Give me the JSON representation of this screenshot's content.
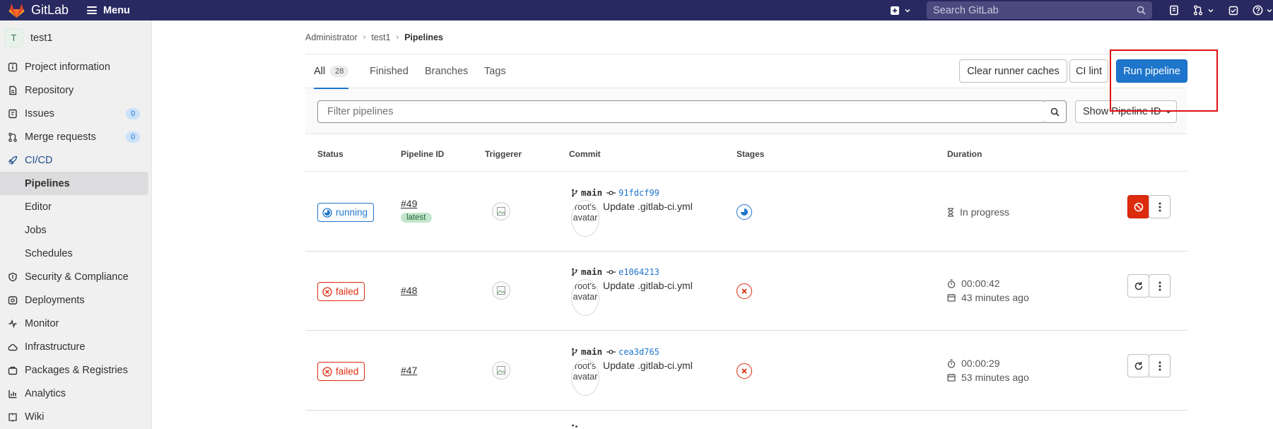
{
  "topbar": {
    "brand": "GitLab",
    "menu_label": "Menu",
    "search_placeholder": "Search GitLab"
  },
  "sidebar": {
    "project_initial": "T",
    "project_name": "test1",
    "items": [
      {
        "label": "Project information",
        "icon": "info-icon"
      },
      {
        "label": "Repository",
        "icon": "doc-icon"
      },
      {
        "label": "Issues",
        "icon": "issues-icon",
        "badge": "0"
      },
      {
        "label": "Merge requests",
        "icon": "merge-request-icon",
        "badge": "0"
      },
      {
        "label": "CI/CD",
        "icon": "rocket-icon"
      }
    ],
    "cicd_sub": [
      "Pipelines",
      "Editor",
      "Jobs",
      "Schedules"
    ],
    "more_items": [
      {
        "label": "Security & Compliance",
        "icon": "shield-icon"
      },
      {
        "label": "Deployments",
        "icon": "deployments-icon"
      },
      {
        "label": "Monitor",
        "icon": "monitor-icon"
      },
      {
        "label": "Infrastructure",
        "icon": "cloud-icon"
      },
      {
        "label": "Packages & Registries",
        "icon": "package-icon"
      },
      {
        "label": "Analytics",
        "icon": "chart-icon"
      },
      {
        "label": "Wiki",
        "icon": "book-icon"
      }
    ]
  },
  "breadcrumb": {
    "items": [
      "Administrator",
      "test1",
      "Pipelines"
    ]
  },
  "tabs": {
    "all": "All",
    "all_count": "28",
    "finished": "Finished",
    "branches": "Branches",
    "tags": "Tags"
  },
  "actions": {
    "clear_cache": "Clear runner caches",
    "ci_lint": "CI lint",
    "run_pipeline": "Run pipeline"
  },
  "filter": {
    "placeholder": "Filter pipelines",
    "show_id": "Show Pipeline ID"
  },
  "table": {
    "headers": [
      "Status",
      "Pipeline ID",
      "Triggerer",
      "Commit",
      "Stages",
      "Duration"
    ],
    "rows": [
      {
        "status": "running",
        "id": "#49",
        "badge": "latest",
        "branch": "main",
        "sha": "91fdcf99",
        "avatar_alt": "root's avatar",
        "message": "Update .gitlab-ci.yml",
        "duration": "In progress",
        "ago": ""
      },
      {
        "status": "failed",
        "id": "#48",
        "badge": "",
        "branch": "main",
        "sha": "e1064213",
        "avatar_alt": "root's avatar",
        "message": "Update .gitlab-ci.yml",
        "duration": "00:00:42",
        "ago": "43 minutes ago"
      },
      {
        "status": "failed",
        "id": "#47",
        "badge": "",
        "branch": "main",
        "sha": "cea3d765",
        "avatar_alt": "root's avatar",
        "message": "Update .gitlab-ci.yml",
        "duration": "00:00:29",
        "ago": "53 minutes ago"
      }
    ]
  },
  "colors": {
    "topbar": "#292961",
    "primary": "#1f75cb",
    "danger": "#dd2b0e",
    "highlight": "#dd1111"
  }
}
